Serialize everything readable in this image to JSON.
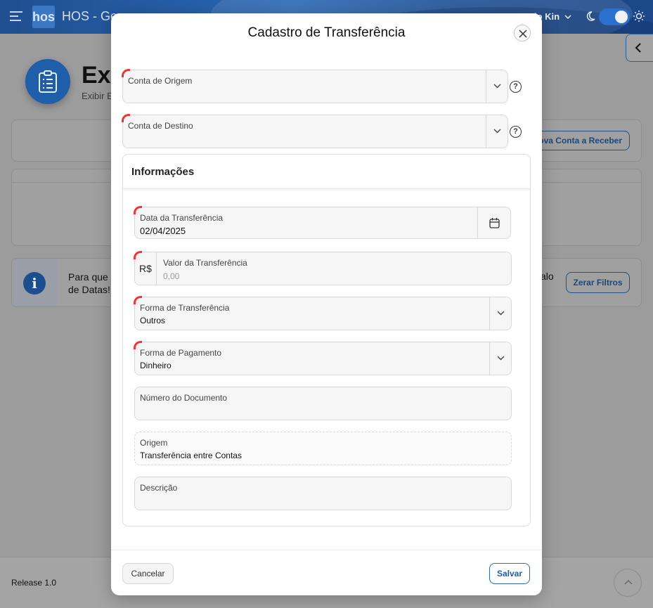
{
  "header": {
    "logo_text": "hos",
    "app_title": "HOS - Ge",
    "user_name": "io Kin"
  },
  "page": {
    "title": "Exi",
    "subtitle": "Exibir E",
    "new_receivable_button": "ova Conta a Receber",
    "alert_text_line1": "Para que o",
    "alert_text_line2": "de Datas!",
    "alert_text_right": "alo",
    "alert_icon_glyph": "i",
    "clear_filters_button": "Zerar Filtros"
  },
  "footer": {
    "release": "Release 1.0"
  },
  "modal": {
    "title": "Cadastro de Transferência",
    "origin_account": {
      "label": "Conta de Origem",
      "value": ""
    },
    "destination_account": {
      "label": "Conta de Destino",
      "value": ""
    },
    "help_glyph": "?",
    "info_section_title": "Informações",
    "transfer_date": {
      "label": "Data da Transferência",
      "value": "02/04/2025"
    },
    "transfer_amount": {
      "label": "Valor da Transferência",
      "prefix": "R$",
      "placeholder": "0,00"
    },
    "transfer_method": {
      "label": "Forma de Transferência",
      "value": "Outros"
    },
    "payment_method": {
      "label": "Forma de Pagamento",
      "value": "Dinheiro"
    },
    "document_number": {
      "label": "Número do Documento",
      "value": ""
    },
    "origin": {
      "label": "Origem",
      "value": "Transferência entre Contas"
    },
    "description": {
      "label": "Descrição",
      "value": ""
    },
    "cancel_button": "Cancelar",
    "save_button": "Salvar"
  },
  "colors": {
    "primary": "#1f5ea8",
    "required_marker": "#e53935",
    "header_bg": "#2a67b5"
  },
  "icons": [
    "menu-icon",
    "moon-icon",
    "sun-icon",
    "chevron-left-icon",
    "clipboard-icon",
    "info-icon",
    "close-icon",
    "help-icon",
    "chevron-down-icon",
    "calendar-icon",
    "chevron-up-icon"
  ]
}
